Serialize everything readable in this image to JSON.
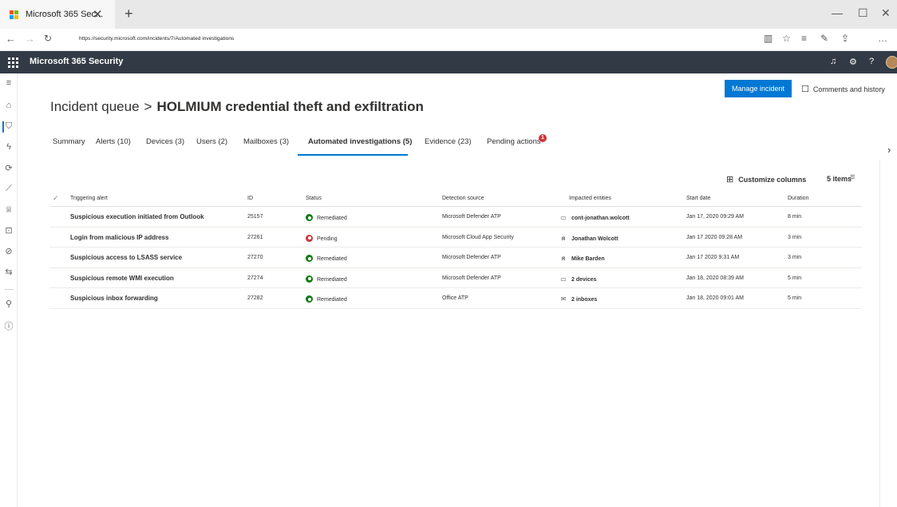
{
  "browser": {
    "tab_title": "Microsoft 365 Sec...",
    "url": "https://security.microsoft.com/incidents/7/Automated investigations",
    "logo_colors": [
      "#f25022",
      "#7fba00",
      "#00a4ef",
      "#ffb900"
    ]
  },
  "header": {
    "app_title": "Microsoft 365 Security"
  },
  "actions": {
    "manage_incident": "Manage incident",
    "comments_history": "Comments and history"
  },
  "page": {
    "breadcrumb_root": "Incident queue",
    "breadcrumb_separator": ">",
    "incident_name": "HOLMIUM credential theft and exfiltration"
  },
  "tabs": [
    {
      "label": "Summary",
      "active": false
    },
    {
      "label": "Alerts (10)",
      "active": false
    },
    {
      "label": "Devices (3)",
      "active": false
    },
    {
      "label": "Users (2)",
      "active": false
    },
    {
      "label": "Mailboxes (3)",
      "active": false
    },
    {
      "label": "Automated investigations (5)",
      "active": true
    },
    {
      "label": "Evidence (23)",
      "active": false
    },
    {
      "label": "Pending actions",
      "active": false
    }
  ],
  "pending_badge": "1",
  "toolbar": {
    "customize_columns": "Customize columns",
    "items_count": "5 items"
  },
  "table": {
    "headers": {
      "alert": "Triggering alert",
      "id": "ID",
      "status": "Status",
      "source": "Detection source",
      "entities": "Impacted entities",
      "start": "Start date",
      "duration": "Duration"
    },
    "rows": [
      {
        "alert": "Suspicious execution initiated from Outlook",
        "id": "25157",
        "status": "Remediated",
        "status_color": "#107c10",
        "source": "Microsoft Defender ATP",
        "entity_icon": "device-icon",
        "entity": "cont-jonathan.wolcott",
        "start": "Jan 17, 2020 09:29 AM",
        "duration": "8 min"
      },
      {
        "alert": "Login from malicious IP address",
        "id": "27261",
        "status": "Pending",
        "status_color": "#d13438",
        "source": "Microsoft Cloud App Security",
        "entity_icon": "user-icon",
        "entity": "Jonathan Wolcott",
        "start": "Jan 17 2020 09:28 AM",
        "duration": "3 min"
      },
      {
        "alert": "Suspicious access to LSASS service",
        "id": "27270",
        "status": "Remediated",
        "status_color": "#107c10",
        "source": "Microsoft Defender ATP",
        "entity_icon": "user-icon",
        "entity": "Mike Barden",
        "start": "Jan 17 2020 9:31 AM",
        "duration": "3 min"
      },
      {
        "alert": "Suspicious remote WMI execution",
        "id": "27274",
        "status": "Remediated",
        "status_color": "#107c10",
        "source": "Microsoft Defender ATP",
        "entity_icon": "device-icon",
        "entity": "2 devices",
        "start": "Jan 18, 2020 08:39 AM",
        "duration": "5 min"
      },
      {
        "alert": "Suspicious inbox forwarding",
        "id": "27282",
        "status": "Remediated",
        "status_color": "#107c10",
        "source": "Office ATP",
        "entity_icon": "mailbox-icon",
        "entity": "2 inboxes",
        "start": "Jan 18, 2020 09:01 AM",
        "duration": "5 min"
      }
    ]
  }
}
